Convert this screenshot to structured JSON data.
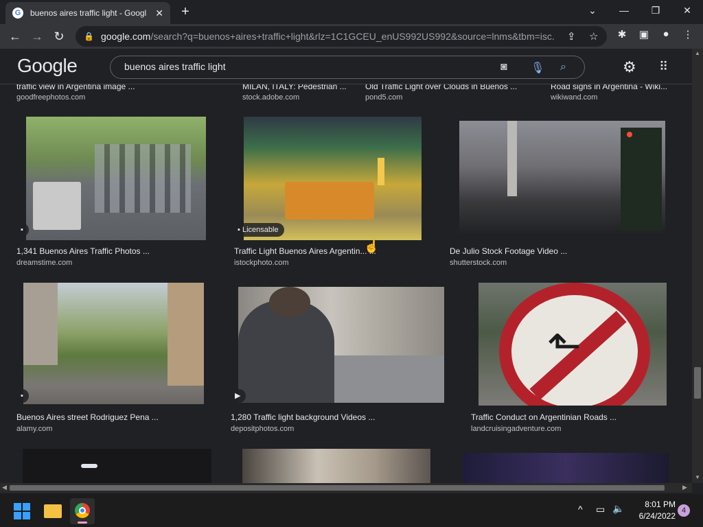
{
  "browser": {
    "tab_title": "buenos aires traffic light - Googl",
    "tab_close": "✕",
    "new_tab": "+",
    "url_host": "google.com",
    "url_path": "/search?q=buenos+aires+traffic+light&rlz=1C1GCEU_enUS992US992&source=lnms&tbm=isc..."
  },
  "google": {
    "logo": "Google",
    "query": "buenos aires traffic light"
  },
  "top_row": [
    {
      "caption": "traffic view in Argentina image ...",
      "source": "goodfreephotos.com"
    },
    {
      "caption": "MILAN, ITALY: Pedestrian ...",
      "source": "stock.adobe.com"
    },
    {
      "caption": "Old Traffic Light over Clouds in Buenos ...",
      "source": "pond5.com"
    },
    {
      "caption": "Road signs in Argentina - Wiki...",
      "source": "wikiwand.com"
    }
  ],
  "row2": [
    {
      "caption": "1,341 Buenos Aires Traffic Photos ...",
      "source": "dreamstime.com"
    },
    {
      "caption": "Traffic Light Buenos Aires Argentin... ...",
      "source": "istockphoto.com",
      "badge": "Licensable"
    },
    {
      "caption": "De Julio Stock Footage Video ...",
      "source": "shutterstock.com"
    }
  ],
  "row3": [
    {
      "caption": "Buenos Aires street Rodriguez Pena ...",
      "source": "alamy.com"
    },
    {
      "caption": "1,280 Traffic light background Videos ...",
      "source": "depositphotos.com"
    },
    {
      "caption": "Traffic Conduct on Argentinian Roads ...",
      "source": "landcruisingadventure.com"
    }
  ],
  "taskbar": {
    "time": "8:01 PM",
    "date": "6/24/2022",
    "notifications": "4"
  },
  "colors": {
    "background": "#202124",
    "toolbar": "#35363a",
    "text": "#e8eaed",
    "subtext": "#bdc1c6"
  }
}
